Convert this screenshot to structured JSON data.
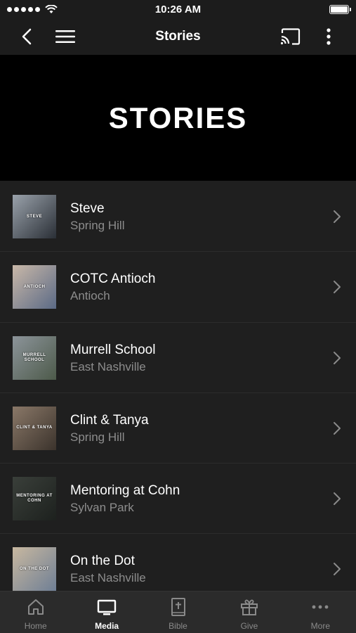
{
  "status_bar": {
    "time": "10:26 AM"
  },
  "nav": {
    "title": "Stories"
  },
  "hero": {
    "title": "STORIES"
  },
  "stories": [
    {
      "title": "Steve",
      "location": "Spring Hill",
      "thumb_label": "STEVE",
      "thumb_colors": [
        "#9aa2ab",
        "#2a2f36"
      ]
    },
    {
      "title": "COTC Antioch",
      "location": "Antioch",
      "thumb_label": "ANTIOCH",
      "thumb_colors": [
        "#c9b8a8",
        "#5b6a86"
      ]
    },
    {
      "title": "Murrell School",
      "location": "East Nashville",
      "thumb_label": "MURRELL SCHOOL",
      "thumb_colors": [
        "#8c949a",
        "#4d5a4a"
      ]
    },
    {
      "title": "Clint & Tanya",
      "location": "Spring Hill",
      "thumb_label": "CLINT & TANYA",
      "thumb_colors": [
        "#8a7868",
        "#3b332c"
      ]
    },
    {
      "title": "Mentoring at Cohn",
      "location": "Sylvan Park",
      "thumb_label": "MENTORING AT COHN",
      "thumb_colors": [
        "#3a3f3a",
        "#1d211e"
      ]
    },
    {
      "title": "On the Dot",
      "location": "East Nashville",
      "thumb_label": "ON THE DOT",
      "thumb_colors": [
        "#c8b8a0",
        "#6f7f95"
      ]
    }
  ],
  "tabs": [
    {
      "label": "Home",
      "icon": "home-icon",
      "active": false
    },
    {
      "label": "Media",
      "icon": "tv-icon",
      "active": true
    },
    {
      "label": "Bible",
      "icon": "bible-icon",
      "active": false
    },
    {
      "label": "Give",
      "icon": "gift-icon",
      "active": false
    },
    {
      "label": "More",
      "icon": "more-icon",
      "active": false
    }
  ],
  "colors": {
    "background": "#1f1f1f",
    "hero": "#000000",
    "subtitle": "#8d8d8d",
    "tab_bar": "#2b2b2b"
  }
}
